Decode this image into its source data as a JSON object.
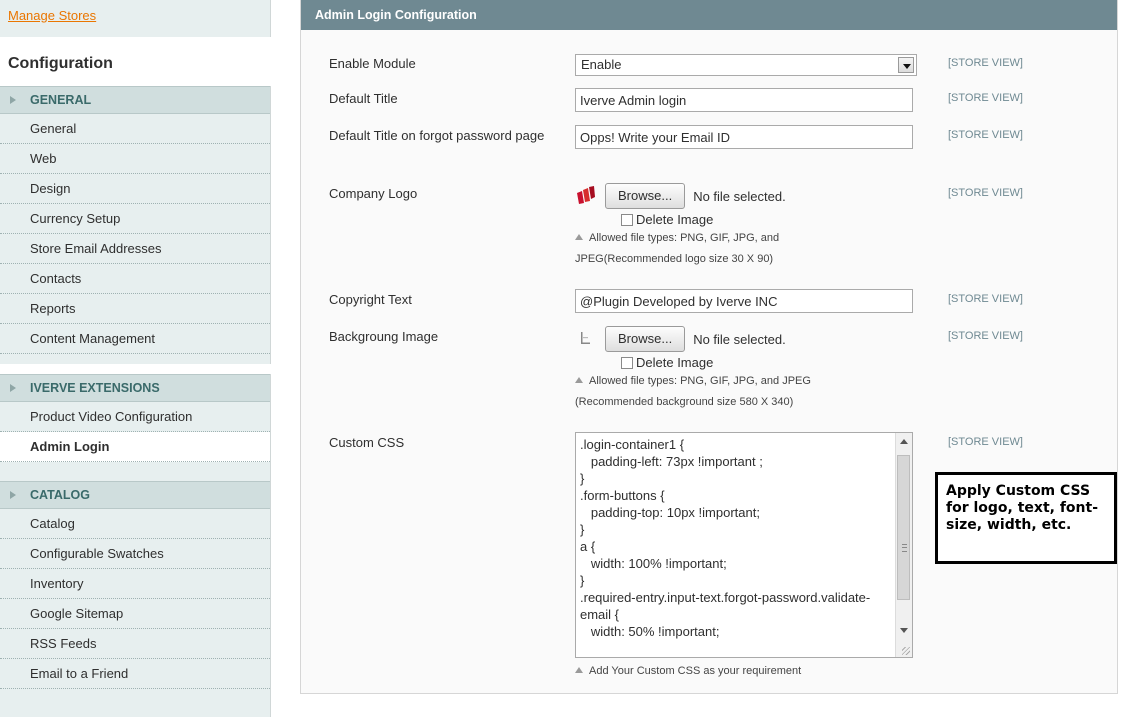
{
  "sidebar": {
    "manage_stores": "Manage Stores",
    "title": "Configuration",
    "sections": [
      {
        "label": "GENERAL",
        "items": [
          {
            "label": "General",
            "active": false
          },
          {
            "label": "Web",
            "active": false
          },
          {
            "label": "Design",
            "active": false
          },
          {
            "label": "Currency Setup",
            "active": false
          },
          {
            "label": "Store Email Addresses",
            "active": false
          },
          {
            "label": "Contacts",
            "active": false
          },
          {
            "label": "Reports",
            "active": false
          },
          {
            "label": "Content Management",
            "active": false
          }
        ]
      },
      {
        "label": "IVERVE EXTENSIONS",
        "items": [
          {
            "label": "Product Video Configuration",
            "active": false
          },
          {
            "label": "Admin Login",
            "active": true
          }
        ]
      },
      {
        "label": "CATALOG",
        "items": [
          {
            "label": "Catalog",
            "active": false
          },
          {
            "label": "Configurable Swatches",
            "active": false
          },
          {
            "label": "Inventory",
            "active": false
          },
          {
            "label": "Google Sitemap",
            "active": false
          },
          {
            "label": "RSS Feeds",
            "active": false
          },
          {
            "label": "Email to a Friend",
            "active": false
          }
        ]
      }
    ]
  },
  "section_title": "Admin Login Configuration",
  "scope_label": "[STORE VIEW]",
  "fields": {
    "enable_module": {
      "label": "Enable Module",
      "value": "Enable"
    },
    "default_title": {
      "label": "Default Title",
      "value": "Iverve Admin login"
    },
    "forgot_title": {
      "label": "Default Title on forgot password page",
      "value": "Opps! Write your Email ID"
    },
    "company_logo": {
      "label": "Company Logo",
      "browse": "Browse...",
      "no_file": "No file selected.",
      "delete": "Delete Image",
      "note": "Allowed file types: PNG, GIF, JPG, and JPEG(Recommended logo size 30 X 90)"
    },
    "copyright": {
      "label": "Copyright Text",
      "value": "@Plugin Developed by Iverve INC"
    },
    "background": {
      "label": "Backgroung Image",
      "browse": "Browse...",
      "no_file": "No file selected.",
      "delete": "Delete Image",
      "note": "Allowed file types: PNG, GIF, JPG, and JPEG (Recommended background size 580 X 340)"
    },
    "custom_css": {
      "label": "Custom CSS",
      "value": ".login-container1 {\n   padding-left: 73px !important ;\n}\n.form-buttons {\n   padding-top: 10px !important;\n}\na {\n   width: 100% !important;\n}\n.required-entry.input-text.forgot-password.validate-email {\n   width: 50% !important;",
      "note": "Add Your Custom CSS as your requirement"
    }
  },
  "callout": "Apply Custom CSS for logo, text, font-size, width, etc.",
  "colors": {
    "header_bg": "#6f8992",
    "sidebar_bg": "#e7efef",
    "link": "#ea7601",
    "scope": "#6f8992"
  }
}
